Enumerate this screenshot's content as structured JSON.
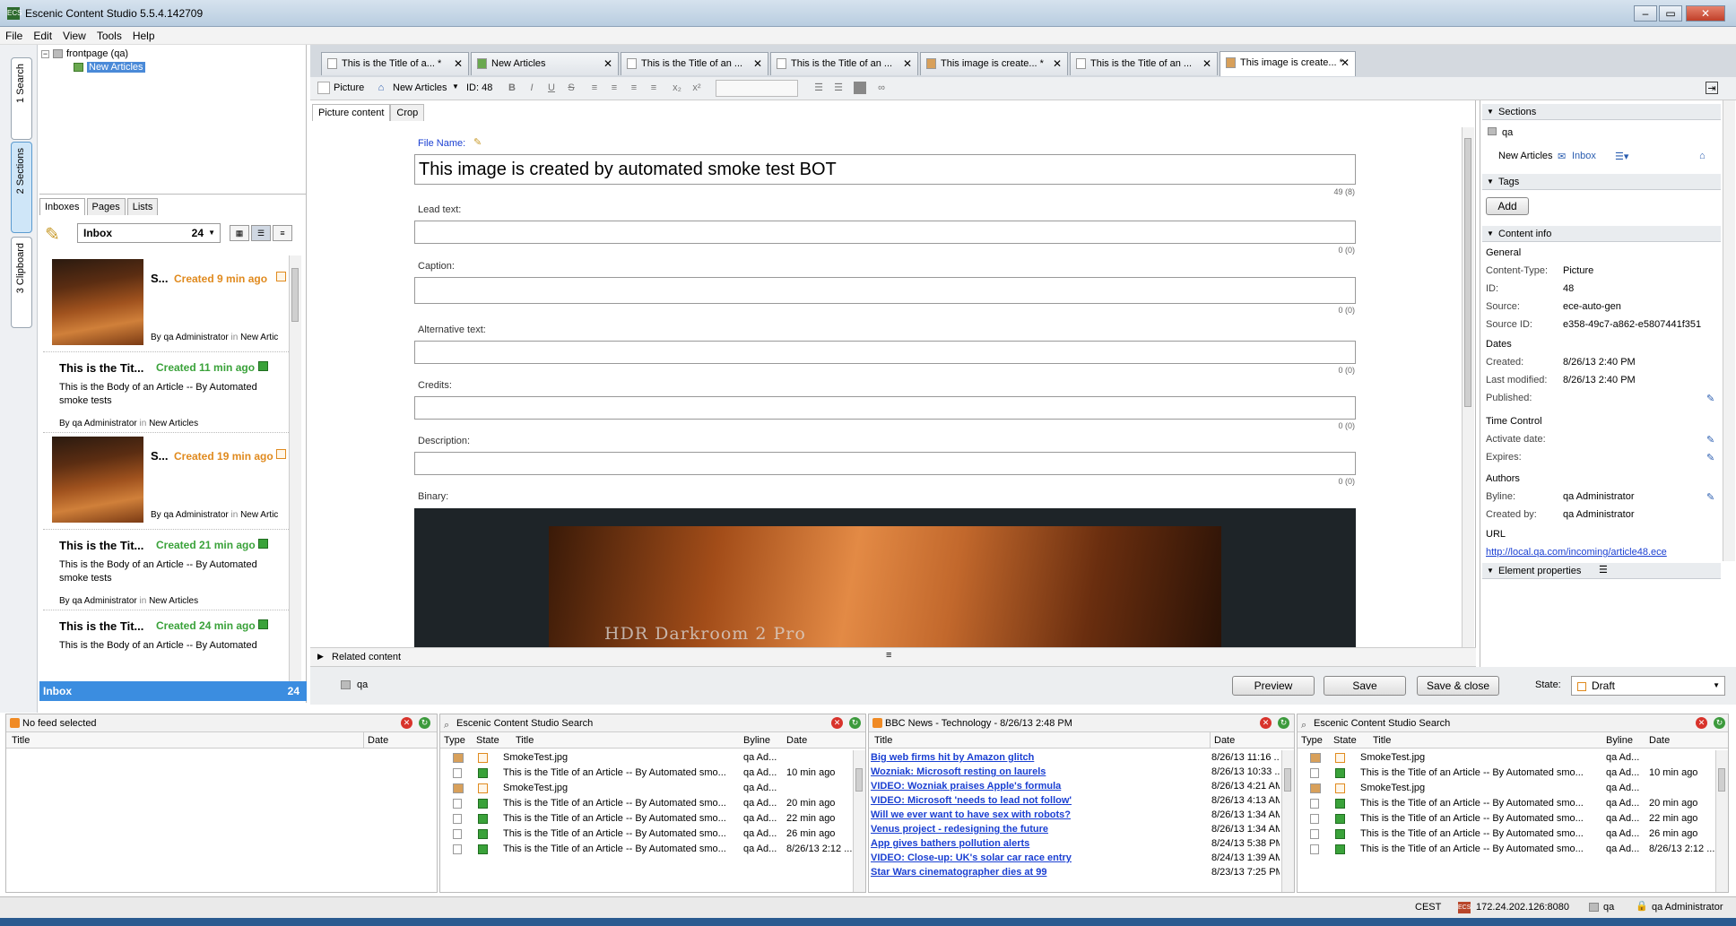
{
  "window": {
    "title": "Escenic Content Studio 5.5.4.142709",
    "logo": "ECS"
  },
  "menu": [
    "File",
    "Edit",
    "View",
    "Tools",
    "Help"
  ],
  "left_tabs": [
    "1 Search",
    "2 Sections",
    "3 Clipboard"
  ],
  "tree": {
    "root": "frontpage (qa)",
    "child": "New Articles"
  },
  "inbox_tabs": [
    "Inboxes",
    "Pages",
    "Lists"
  ],
  "inbox": {
    "name": "Inbox",
    "count": "24"
  },
  "inbox_items": [
    {
      "title": "S...",
      "ago": "Created 9 min ago",
      "by": "By",
      "author": "qa Administrator",
      "in": "in",
      "section": "New Artic"
    },
    {
      "title": "This is the Tit...",
      "ago": "Created 11 min ago",
      "body": "This is the Body of an Article -- By Automated smoke tests",
      "by": "By",
      "author": "qa Administrator",
      "in": "in",
      "section": "New Articles"
    },
    {
      "title": "S...",
      "ago": "Created 19 min ago",
      "by": "By",
      "author": "qa Administrator",
      "in": "in",
      "section": "New Artic"
    },
    {
      "title": "This is the Tit...",
      "ago": "Created 21 min ago",
      "body": "This is the Body of an Article -- By Automated smoke tests",
      "by": "By",
      "author": "qa Administrator",
      "in": "in",
      "section": "New Articles"
    },
    {
      "title": "This is the Tit...",
      "ago": "Created 24 min ago",
      "body": "This is the Body of an Article -- By Automated"
    }
  ],
  "doc_tabs": [
    "This is the Title of a... *",
    "New Articles",
    "This is the Title of an ...",
    "This is the Title of an ...",
    "This image is create... *",
    "This is the Title of an ...",
    "This image is create... *"
  ],
  "toolbar": {
    "type": "Picture",
    "section": "New Articles",
    "id": "ID: 48"
  },
  "editor_tabs": [
    "Picture content",
    "Crop"
  ],
  "fields": {
    "file_name_label": "File Name:",
    "file_name_value": "This image is created by automated smoke test BOT",
    "file_name_count": "49 (8)",
    "lead_label": "Lead text:",
    "caption_label": "Caption:",
    "alt_label": "Alternative text:",
    "credits_label": "Credits:",
    "description_label": "Description:",
    "binary_label": "Binary:",
    "zero_count": "0 (0)",
    "watermark": "HDR Darkroom 2 Pro"
  },
  "related": {
    "label": "Related content",
    "section": "qa"
  },
  "buttons": {
    "preview": "Preview",
    "save": "Save",
    "save_close": "Save & close",
    "state_label": "State:",
    "state_value": "Draft"
  },
  "right": {
    "sections_header": "Sections",
    "section_name": "qa",
    "section_home": "New Articles",
    "section_inbox": "Inbox",
    "tags_header": "Tags",
    "add_label": "Add",
    "content_info_header": "Content info",
    "general": "General",
    "content_type_label": "Content-Type:",
    "content_type": "Picture",
    "id_label": "ID:",
    "id": "48",
    "source_label": "Source:",
    "source": "ece-auto-gen",
    "source_id_label": "Source ID:",
    "source_id": "e358-49c7-a862-e5807441f351",
    "dates": "Dates",
    "created_label": "Created:",
    "created": "8/26/13 2:40 PM",
    "modified_label": "Last modified:",
    "modified": "8/26/13 2:40 PM",
    "published_label": "Published:",
    "time_control": "Time Control",
    "activate_label": "Activate date:",
    "expires_label": "Expires:",
    "authors": "Authors",
    "byline_label": "Byline:",
    "byline": "qa Administrator",
    "created_by_label": "Created by:",
    "created_by": "qa Administrator",
    "url_header": "URL",
    "url": "http://local.qa.com/incoming/article48.ece",
    "element_props": "Element properties"
  },
  "feed1": {
    "title": "No feed selected",
    "cols": [
      "Title",
      "Date"
    ]
  },
  "search1": {
    "title": "Escenic Content Studio Search",
    "cols": [
      "Type",
      "State",
      "Title",
      "Byline",
      "Date"
    ],
    "rows": [
      {
        "title": "SmokeTest.jpg",
        "byline": "qa Ad...",
        "date": "",
        "kind": "img"
      },
      {
        "title": "This is the Title of an Article -- By Automated smo...",
        "byline": "qa Ad...",
        "date": "10 min ago",
        "kind": "doc"
      },
      {
        "title": "SmokeTest.jpg",
        "byline": "qa Ad...",
        "date": "",
        "kind": "img"
      },
      {
        "title": "This is the Title of an Article -- By Automated smo...",
        "byline": "qa Ad...",
        "date": "20 min ago",
        "kind": "doc"
      },
      {
        "title": "This is the Title of an Article -- By Automated smo...",
        "byline": "qa Ad...",
        "date": "22 min ago",
        "kind": "doc"
      },
      {
        "title": "This is the Title of an Article -- By Automated smo...",
        "byline": "qa Ad...",
        "date": "26 min ago",
        "kind": "doc"
      },
      {
        "title": "This is the Title of an Article -- By Automated smo...",
        "byline": "qa Ad...",
        "date": "8/26/13 2:12 ...",
        "kind": "doc"
      }
    ]
  },
  "bbc": {
    "title": "BBC News - Technology - 8/26/13 2:48 PM",
    "cols": [
      "Title",
      "Date"
    ],
    "rows": [
      {
        "title": "Big web firms hit by Amazon glitch",
        "date": "8/26/13 11:16 ..."
      },
      {
        "title": "Wozniak: Microsoft resting on laurels",
        "date": "8/26/13 10:33 ..."
      },
      {
        "title": "VIDEO: Wozniak praises Apple's formula",
        "date": "8/26/13 4:21 AM"
      },
      {
        "title": "VIDEO: Microsoft 'needs to lead not follow'",
        "date": "8/26/13 4:13 AM"
      },
      {
        "title": "Will we ever want to have sex with robots?",
        "date": "8/26/13 1:34 AM"
      },
      {
        "title": "Venus project - redesigning the future",
        "date": "8/26/13 1:34 AM"
      },
      {
        "title": "App gives bathers pollution alerts",
        "date": "8/24/13 5:38 PM"
      },
      {
        "title": "VIDEO: Close-up: UK's solar car race entry",
        "date": "8/24/13 1:39 AM"
      },
      {
        "title": "Star Wars cinematographer dies at 99",
        "date": "8/23/13 7:25 PM"
      }
    ]
  },
  "search2": {
    "title": "Escenic Content Studio Search"
  },
  "status": {
    "tz": "CEST",
    "server": "172.24.202.126:8080",
    "pub": "qa",
    "user": "qa Administrator"
  }
}
